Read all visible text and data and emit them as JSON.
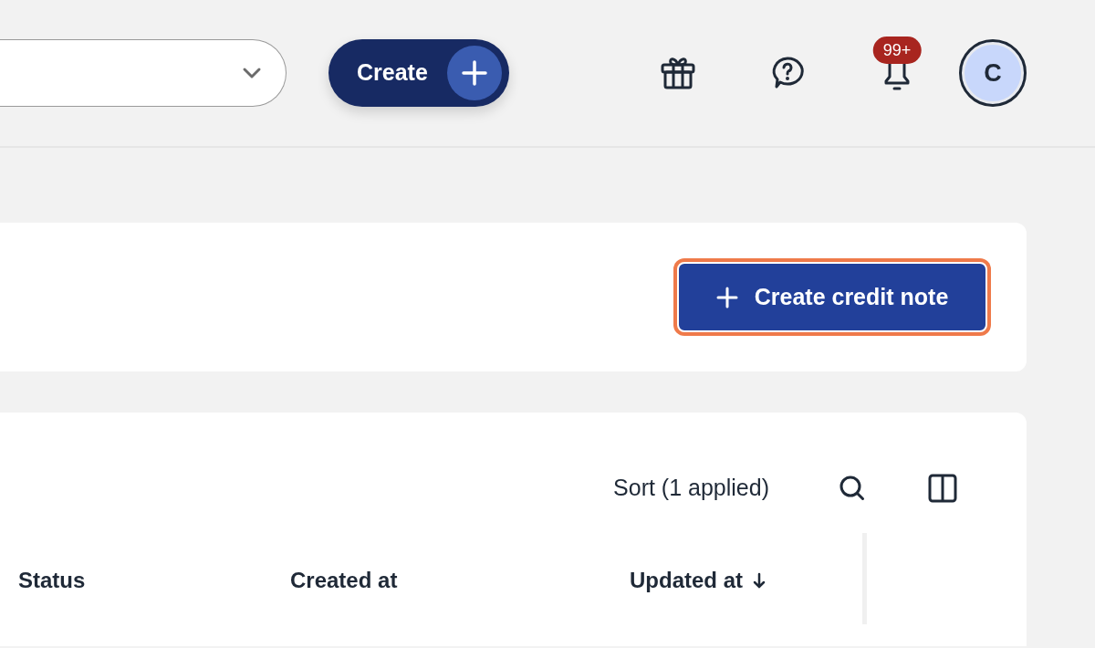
{
  "header": {
    "create_button": {
      "label": "Create"
    },
    "notifications": {
      "badge": "99+"
    },
    "avatar": {
      "initial": "C"
    }
  },
  "actions_card": {
    "button": {
      "label": "Create credit note",
      "focused": true
    }
  },
  "table": {
    "toolbar": {
      "sort_label": "Sort (1 applied)"
    },
    "columns": [
      {
        "label": "Status",
        "sorted": false
      },
      {
        "label": "Created at",
        "sorted": false
      },
      {
        "label": "Updated at",
        "sorted": true
      }
    ]
  }
}
